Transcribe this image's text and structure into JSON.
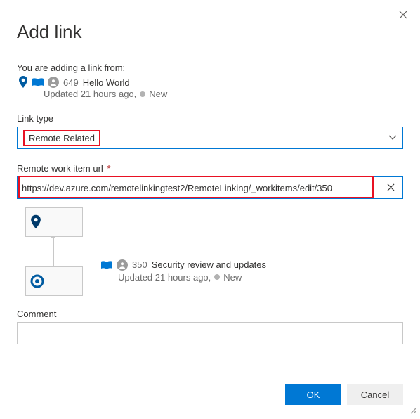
{
  "dialog": {
    "title": "Add link",
    "from_label": "You are adding a link from:",
    "close_icon": "close"
  },
  "source_item": {
    "id": "649",
    "title": "Hello World",
    "updated": "Updated 21 hours ago,",
    "state": "New"
  },
  "link_type": {
    "label": "Link type",
    "value": "Remote Related"
  },
  "remote_url": {
    "label": "Remote work item url",
    "required": "*",
    "value": "https://dev.azure.com/remotelinkingtest2/RemoteLinking/_workitems/edit/350"
  },
  "related_item": {
    "id": "350",
    "title": "Security review and updates",
    "updated": "Updated 21 hours ago,",
    "state": "New"
  },
  "comment": {
    "label": "Comment",
    "value": ""
  },
  "buttons": {
    "ok": "OK",
    "cancel": "Cancel"
  },
  "colors": {
    "primary": "#0078d4",
    "highlight": "#e81123"
  }
}
